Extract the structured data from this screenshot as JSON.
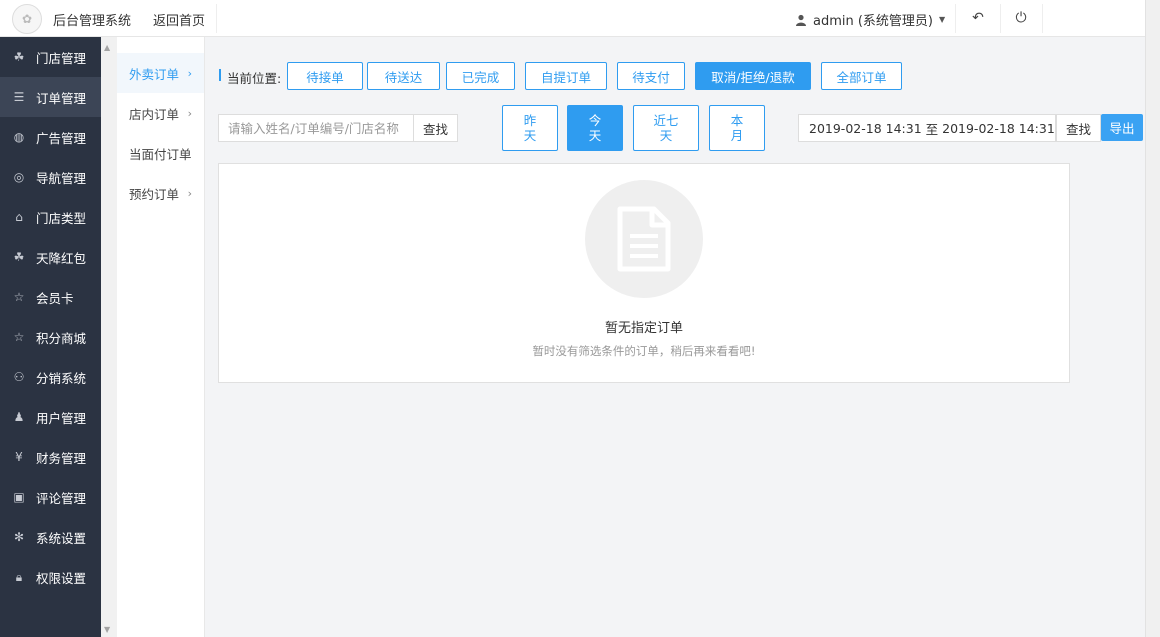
{
  "header": {
    "app_title": "后台管理系统",
    "home_link": "返回首页",
    "user_label": "admin (系统管理员)"
  },
  "sidebar": {
    "items": [
      {
        "label": "门店管理",
        "icon": "cubes-icon",
        "glyph": "☘"
      },
      {
        "label": "订单管理",
        "icon": "list-icon",
        "glyph": "☰"
      },
      {
        "label": "广告管理",
        "icon": "globe-icon",
        "glyph": "◍"
      },
      {
        "label": "导航管理",
        "icon": "compass-icon",
        "glyph": "◎"
      },
      {
        "label": "门店类型",
        "icon": "bank-icon",
        "glyph": "⌂"
      },
      {
        "label": "天降红包",
        "icon": "cubes-icon",
        "glyph": "☘"
      },
      {
        "label": "会员卡",
        "icon": "star-icon",
        "glyph": "☆"
      },
      {
        "label": "积分商城",
        "icon": "star-icon",
        "glyph": "☆"
      },
      {
        "label": "分销系统",
        "icon": "users-icon",
        "glyph": "⚇"
      },
      {
        "label": "用户管理",
        "icon": "user-icon",
        "glyph": "♟"
      },
      {
        "label": "财务管理",
        "icon": "yen-icon",
        "glyph": "¥"
      },
      {
        "label": "评论管理",
        "icon": "money-icon",
        "glyph": "▣"
      },
      {
        "label": "系统设置",
        "icon": "gear-icon",
        "glyph": "✻"
      },
      {
        "label": "权限设置",
        "icon": "lock-icon",
        "glyph": "🔒︎"
      }
    ]
  },
  "submenu": {
    "items": [
      {
        "label": "外卖订单",
        "chevron": "›"
      },
      {
        "label": "店内订单",
        "chevron": "›"
      },
      {
        "label": "当面付订单",
        "chevron": ""
      },
      {
        "label": "预约订单",
        "chevron": "›"
      }
    ]
  },
  "main": {
    "location_label": "当前位置:",
    "tabs": [
      "待接单",
      "待送达",
      "已完成",
      "自提订单",
      "待支付",
      "取消/拒绝/退款",
      "全部订单"
    ],
    "search": {
      "placeholder": "请输入姓名/订单编号/门店名称",
      "button": "查找"
    },
    "date_buttons": [
      "昨天",
      "今天",
      "近七天",
      "本月"
    ],
    "date_range": {
      "start": "2019-02-18 14:31",
      "separator": "至",
      "end": "2019-02-18 14:31",
      "find_button": "查找",
      "export_button": "导出"
    },
    "empty": {
      "title": "暂无指定订单",
      "subtitle": "暂时没有筛选条件的订单，稍后再来看看吧!"
    }
  },
  "colors": {
    "accent": "#2f9cf0",
    "sidebar_bg": "#2b3342"
  }
}
